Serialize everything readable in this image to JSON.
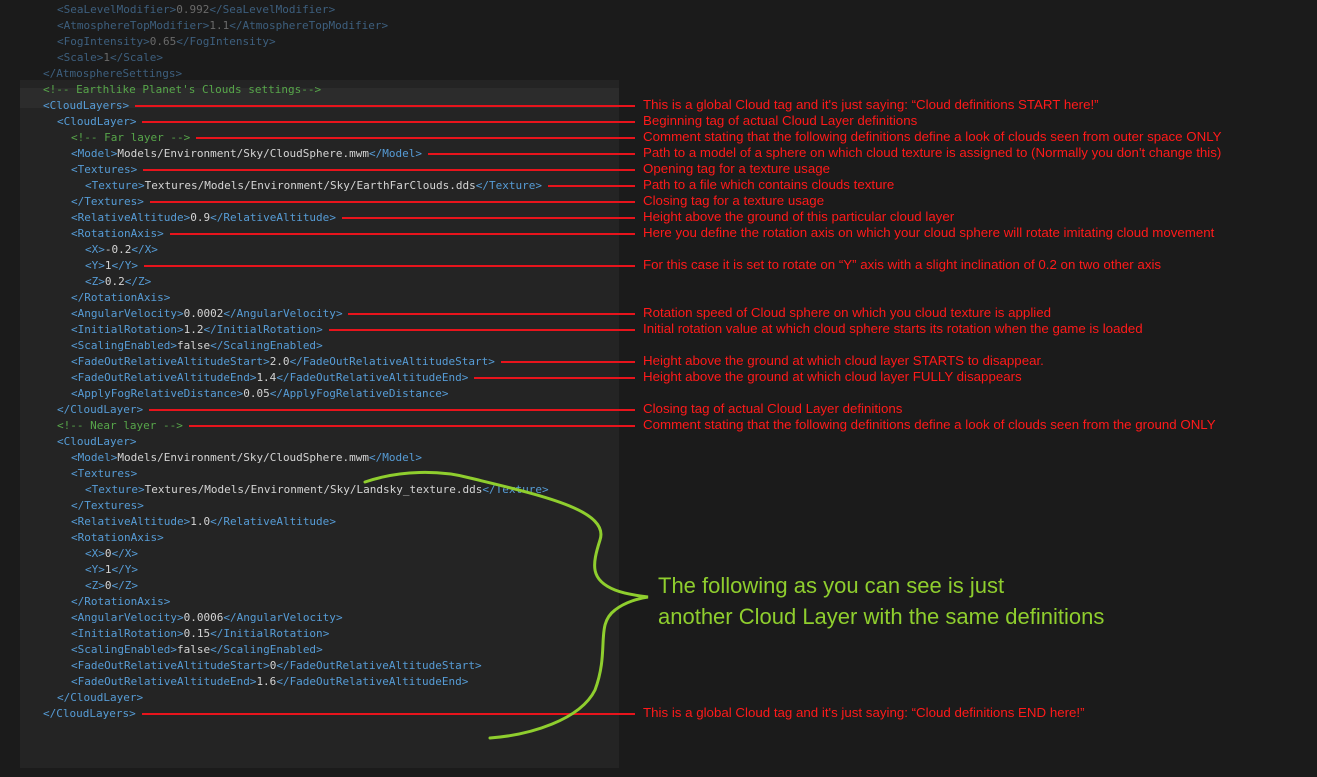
{
  "code_lines": [
    {
      "indent": 3,
      "dim": true,
      "open": "SeaLevelModifier",
      "value": "0.992",
      "close": "SeaLevelModifier"
    },
    {
      "indent": 3,
      "dim": true,
      "open": "AtmosphereTopModifier",
      "value": "1.1",
      "close": "AtmosphereTopModifier"
    },
    {
      "indent": 3,
      "dim": true,
      "open": "FogIntensity",
      "value": "0.65",
      "close": "FogIntensity"
    },
    {
      "indent": 3,
      "dim": true,
      "open": "Scale",
      "value": "1",
      "close": "Scale"
    },
    {
      "indent": 2,
      "dim": true,
      "close": "AtmosphereSettings"
    },
    {
      "indent": 2,
      "comment": "<!-- Earthlike Planet's Clouds settings-->"
    },
    {
      "indent": 2,
      "open": "CloudLayers"
    },
    {
      "indent": 3,
      "open": "CloudLayer"
    },
    {
      "indent": 4,
      "comment": "<!-- Far layer -->"
    },
    {
      "indent": 4,
      "open": "Model",
      "value": "Models/Environment/Sky/CloudSphere.mwm",
      "close": "Model"
    },
    {
      "indent": 4,
      "open": "Textures"
    },
    {
      "indent": 5,
      "open": "Texture",
      "value": "Textures/Models/Environment/Sky/EarthFarClouds.dds",
      "close": "Texture"
    },
    {
      "indent": 4,
      "close": "Textures"
    },
    {
      "indent": 4,
      "open": "RelativeAltitude",
      "value": "0.9",
      "close": "RelativeAltitude"
    },
    {
      "indent": 4,
      "open": "RotationAxis"
    },
    {
      "indent": 5,
      "open": "X",
      "value": "-0.2",
      "close": "X"
    },
    {
      "indent": 5,
      "open": "Y",
      "value": "1",
      "close": "Y"
    },
    {
      "indent": 5,
      "open": "Z",
      "value": "0.2",
      "close": "Z"
    },
    {
      "indent": 4,
      "close": "RotationAxis"
    },
    {
      "indent": 4,
      "open": "AngularVelocity",
      "value": "0.0002",
      "close": "AngularVelocity"
    },
    {
      "indent": 4,
      "open": "InitialRotation",
      "value": "1.2",
      "close": "InitialRotation"
    },
    {
      "indent": 4,
      "open": "ScalingEnabled",
      "value": "false",
      "close": "ScalingEnabled"
    },
    {
      "indent": 4,
      "open": "FadeOutRelativeAltitudeStart",
      "value": "2.0",
      "close": "FadeOutRelativeAltitudeStart"
    },
    {
      "indent": 4,
      "open": "FadeOutRelativeAltitudeEnd",
      "value": "1.4",
      "close": "FadeOutRelativeAltitudeEnd"
    },
    {
      "indent": 4,
      "open": "ApplyFogRelativeDistance",
      "value": "0.05",
      "close": "ApplyFogRelativeDistance"
    },
    {
      "indent": 3,
      "close": "CloudLayer"
    },
    {
      "indent": 3,
      "comment": "<!-- Near layer -->"
    },
    {
      "indent": 3,
      "open": "CloudLayer"
    },
    {
      "indent": 4,
      "open": "Model",
      "value": "Models/Environment/Sky/CloudSphere.mwm",
      "close": "Model"
    },
    {
      "indent": 4,
      "open": "Textures"
    },
    {
      "indent": 5,
      "open": "Texture",
      "value": "Textures/Models/Environment/Sky/Landsky_texture.dds",
      "close": "Texture"
    },
    {
      "indent": 4,
      "close": "Textures"
    },
    {
      "indent": 4,
      "open": "RelativeAltitude",
      "value": "1.0",
      "close": "RelativeAltitude"
    },
    {
      "indent": 4,
      "open": "RotationAxis"
    },
    {
      "indent": 5,
      "open": "X",
      "value": "0",
      "close": "X"
    },
    {
      "indent": 5,
      "open": "Y",
      "value": "1",
      "close": "Y"
    },
    {
      "indent": 5,
      "open": "Z",
      "value": "0",
      "close": "Z"
    },
    {
      "indent": 4,
      "close": "RotationAxis"
    },
    {
      "indent": 4,
      "open": "AngularVelocity",
      "value": "0.0006",
      "close": "AngularVelocity"
    },
    {
      "indent": 4,
      "open": "InitialRotation",
      "value": "0.15",
      "close": "InitialRotation"
    },
    {
      "indent": 4,
      "open": "ScalingEnabled",
      "value": "false",
      "close": "ScalingEnabled"
    },
    {
      "indent": 4,
      "open": "FadeOutRelativeAltitudeStart",
      "value": "0",
      "close": "FadeOutRelativeAltitudeStart"
    },
    {
      "indent": 4,
      "open": "FadeOutRelativeAltitudeEnd",
      "value": "1.6",
      "close": "FadeOutRelativeAltitudeEnd"
    },
    {
      "indent": 3,
      "close": "CloudLayer"
    },
    {
      "indent": 2,
      "close": "CloudLayers"
    }
  ],
  "annotations": [
    {
      "line": 6,
      "text": "This is a global Cloud tag and it's just saying: “Cloud definitions START here!”"
    },
    {
      "line": 7,
      "text": "Beginning tag of actual Cloud Layer definitions"
    },
    {
      "line": 8,
      "text": "Comment stating that the following definitions define a look of clouds seen from outer space ONLY"
    },
    {
      "line": 9,
      "text": "Path to a model of a sphere on which cloud texture is assigned to (Normally you don't change this)"
    },
    {
      "line": 10,
      "text": "Opening tag for a texture usage"
    },
    {
      "line": 11,
      "text": "Path to a file which contains clouds texture"
    },
    {
      "line": 12,
      "text": "Closing tag for a texture usage"
    },
    {
      "line": 13,
      "text": "Height above the ground of this particular cloud layer"
    },
    {
      "line": 14,
      "text": "Here you define the rotation axis on which your cloud sphere will rotate imitating cloud movement"
    },
    {
      "line": 16,
      "text": "For this case it is set to rotate on “Y” axis with a slight inclination of 0.2 on two other axis"
    },
    {
      "line": 19,
      "text": "Rotation speed of Cloud sphere on which you cloud texture is applied"
    },
    {
      "line": 20,
      "text": "Initial rotation value at which cloud sphere starts its rotation when the game is loaded"
    },
    {
      "line": 22,
      "text": "Height above the ground at which cloud layer STARTS to disappear."
    },
    {
      "line": 23,
      "text": "Height above the ground at which cloud layer FULLY disappears"
    },
    {
      "line": 25,
      "text": "Closing tag of actual Cloud Layer definitions"
    },
    {
      "line": 26,
      "text": "Comment stating that the following definitions define a look of clouds seen from the ground ONLY"
    },
    {
      "line": 44,
      "text": "This is a global Cloud tag and it's just saying: “Cloud definitions END here!”"
    }
  ],
  "green_note": {
    "line1": "The following as you can see is just",
    "line2": "another Cloud Layer with the same definitions"
  },
  "colors": {
    "background": "#1b1b1b",
    "panel": "#242424",
    "tag": "#569cd6",
    "text": "#d4d4d4",
    "comment": "#57a64a",
    "annotation": "#ff1a1a",
    "arrow": "#e8141c",
    "highlight": "#8fce2e"
  }
}
